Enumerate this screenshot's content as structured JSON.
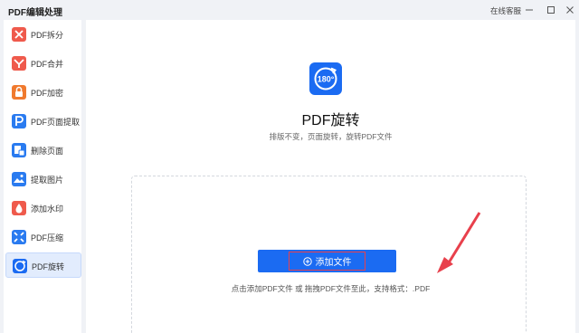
{
  "app": {
    "title": "PDF编辑处理",
    "support": "在线客服"
  },
  "sidebar": {
    "items": [
      {
        "label": "PDF拆分",
        "icon": "split-icon",
        "color": "#ef5a4c"
      },
      {
        "label": "PDF合并",
        "icon": "merge-icon",
        "color": "#ef5a4c"
      },
      {
        "label": "PDF加密",
        "icon": "lock-icon",
        "color": "#f07a2e"
      },
      {
        "label": "PDF页面提取",
        "icon": "extract-page-icon",
        "color": "#2a7bf0"
      },
      {
        "label": "删除页面",
        "icon": "delete-page-icon",
        "color": "#2a7bf0"
      },
      {
        "label": "提取图片",
        "icon": "image-icon",
        "color": "#2a7bf0"
      },
      {
        "label": "添加水印",
        "icon": "watermark-icon",
        "color": "#ef5a4c"
      },
      {
        "label": "PDF压缩",
        "icon": "compress-icon",
        "color": "#2a7bf0"
      },
      {
        "label": "PDF旋转",
        "icon": "rotate-icon",
        "color": "#1b6bf2",
        "active": true
      }
    ]
  },
  "main": {
    "icon_text": "180°",
    "title": "PDF旋转",
    "subtitle": "排版不变，页面旋转，旋转PDF文件",
    "add_button": "添加文件",
    "hint": "点击添加PDF文件 或 拖拽PDF文件至此，支持格式：.PDF"
  },
  "colors": {
    "accent": "#1b6bf2",
    "highlight": "#e8404c"
  }
}
